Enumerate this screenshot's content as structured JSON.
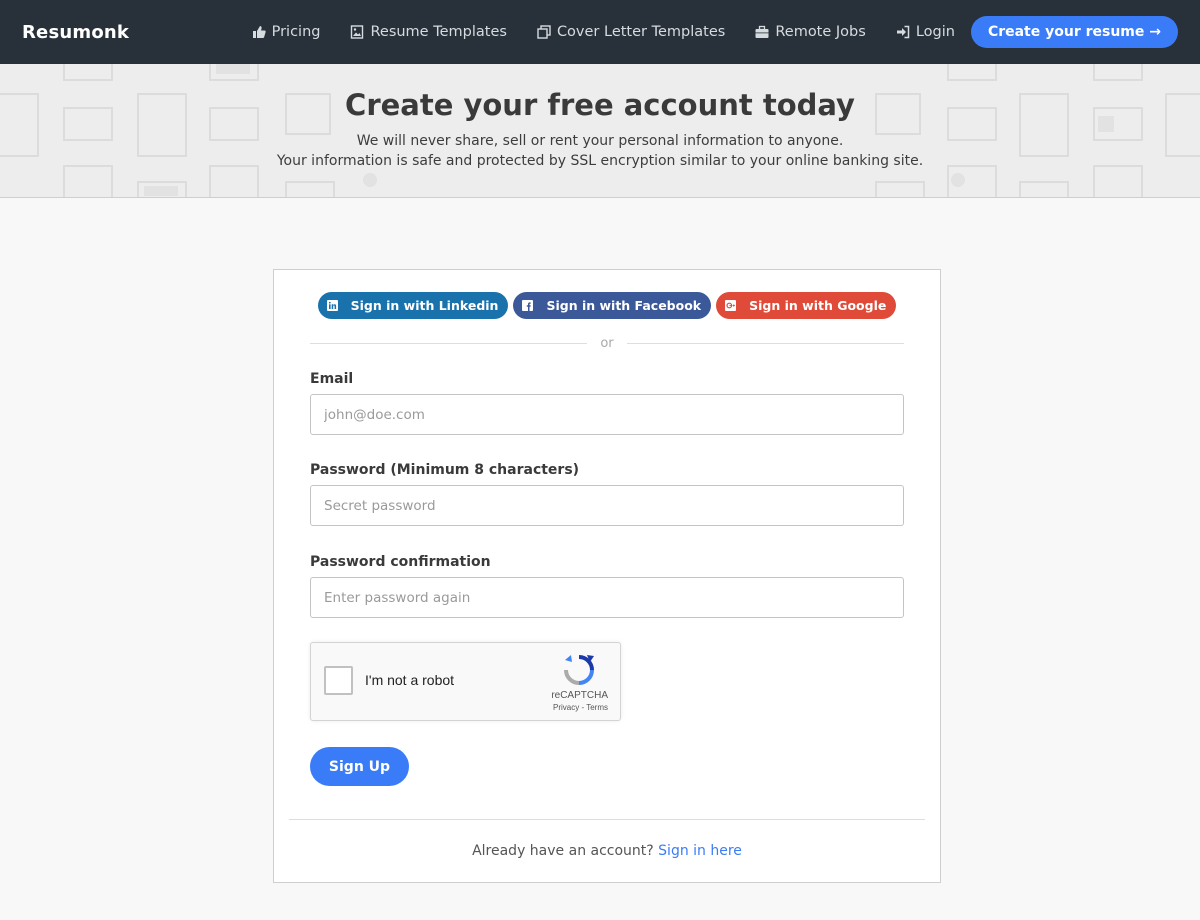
{
  "navbar": {
    "brand": "Resumonk",
    "items": [
      {
        "label": "Pricing",
        "icon": "thumbs-up-icon"
      },
      {
        "label": "Resume Templates",
        "icon": "image-icon"
      },
      {
        "label": "Cover Letter Templates",
        "icon": "copy-icon"
      },
      {
        "label": "Remote Jobs",
        "icon": "briefcase-icon"
      },
      {
        "label": "Login",
        "icon": "sign-in-icon"
      }
    ],
    "cta": "Create your resume →"
  },
  "hero": {
    "title": "Create your free account today",
    "line1": "We will never share, sell or rent your personal information to anyone.",
    "line2": "Your information is safe and protected by SSL encryption similar to your online banking site."
  },
  "social": {
    "linkedin": "Sign in with Linkedin",
    "facebook": "Sign in with Facebook",
    "google": "Sign in with Google"
  },
  "divider": "or",
  "form": {
    "email_label": "Email",
    "email_placeholder": "john@doe.com",
    "password_label": "Password (Minimum 8 characters)",
    "password_placeholder": "Secret password",
    "confirm_label": "Password confirmation",
    "confirm_placeholder": "Enter password again",
    "submit": "Sign Up"
  },
  "captcha": {
    "label": "I'm not a robot",
    "brand": "reCAPTCHA",
    "links": "Privacy - Terms"
  },
  "footer": {
    "text": "Already have an account?",
    "link": "Sign in here"
  },
  "colors": {
    "navbar": "#283039",
    "primary": "#3a7cf7",
    "linkedin": "#1a72ad",
    "facebook": "#3b5898",
    "google": "#df4b38"
  }
}
